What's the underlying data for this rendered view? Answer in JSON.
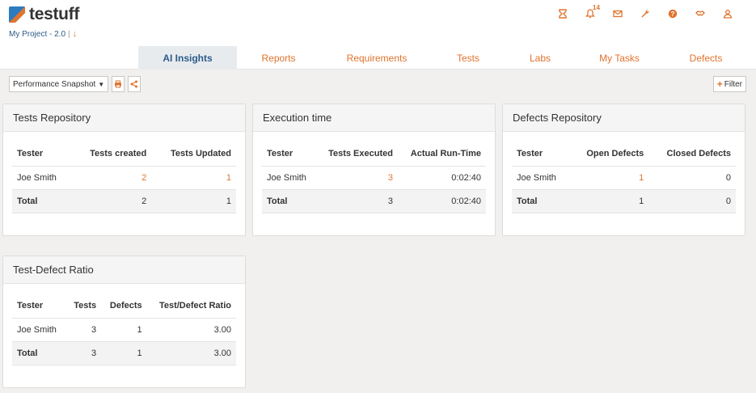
{
  "app": {
    "name": "testuff",
    "project": "My Project - 2.0",
    "project_sep": "|",
    "project_arrow": "↓",
    "notifications_count": "14"
  },
  "header_icons": [
    {
      "name": "hourglass-icon"
    },
    {
      "name": "bell-icon"
    },
    {
      "name": "mail-icon"
    },
    {
      "name": "wrench-icon"
    },
    {
      "name": "help-icon"
    },
    {
      "name": "handshake-icon"
    },
    {
      "name": "user-icon"
    }
  ],
  "tabs": [
    {
      "label": "AI Insights",
      "active": true
    },
    {
      "label": "Reports"
    },
    {
      "label": "Requirements"
    },
    {
      "label": "Tests"
    },
    {
      "label": "Labs"
    },
    {
      "label": "My Tasks"
    },
    {
      "label": "Defects"
    }
  ],
  "toolbar": {
    "view_select": "Performance Snapshot",
    "filter_label": "Filter"
  },
  "widgets": {
    "tests_repository": {
      "title": "Tests Repository",
      "columns": [
        "Tester",
        "Tests created",
        "Tests Updated"
      ],
      "rows": [
        [
          "Joe Smith",
          "2",
          "1"
        ]
      ],
      "total": [
        "Total",
        "2",
        "1"
      ]
    },
    "execution_time": {
      "title": "Execution time",
      "columns": [
        "Tester",
        "Tests Executed",
        "Actual Run-Time"
      ],
      "rows": [
        [
          "Joe Smith",
          "3",
          "0:02:40"
        ]
      ],
      "total": [
        "Total",
        "3",
        "0:02:40"
      ]
    },
    "defects_repository": {
      "title": "Defects Repository",
      "columns": [
        "Tester",
        "Open Defects",
        "Closed Defects"
      ],
      "rows": [
        [
          "Joe Smith",
          "1",
          "0"
        ]
      ],
      "total": [
        "Total",
        "1",
        "0"
      ]
    },
    "test_defect_ratio": {
      "title": "Test-Defect Ratio",
      "columns": [
        "Tester",
        "Tests",
        "Defects",
        "Test/Defect Ratio"
      ],
      "rows": [
        [
          "Joe Smith",
          "3",
          "1",
          "3.00"
        ]
      ],
      "total": [
        "Total",
        "3",
        "1",
        "3.00"
      ]
    }
  },
  "colors": {
    "accent": "#e0732d",
    "link_blue": "#2b5b8a",
    "background": "#f1f0ee"
  }
}
